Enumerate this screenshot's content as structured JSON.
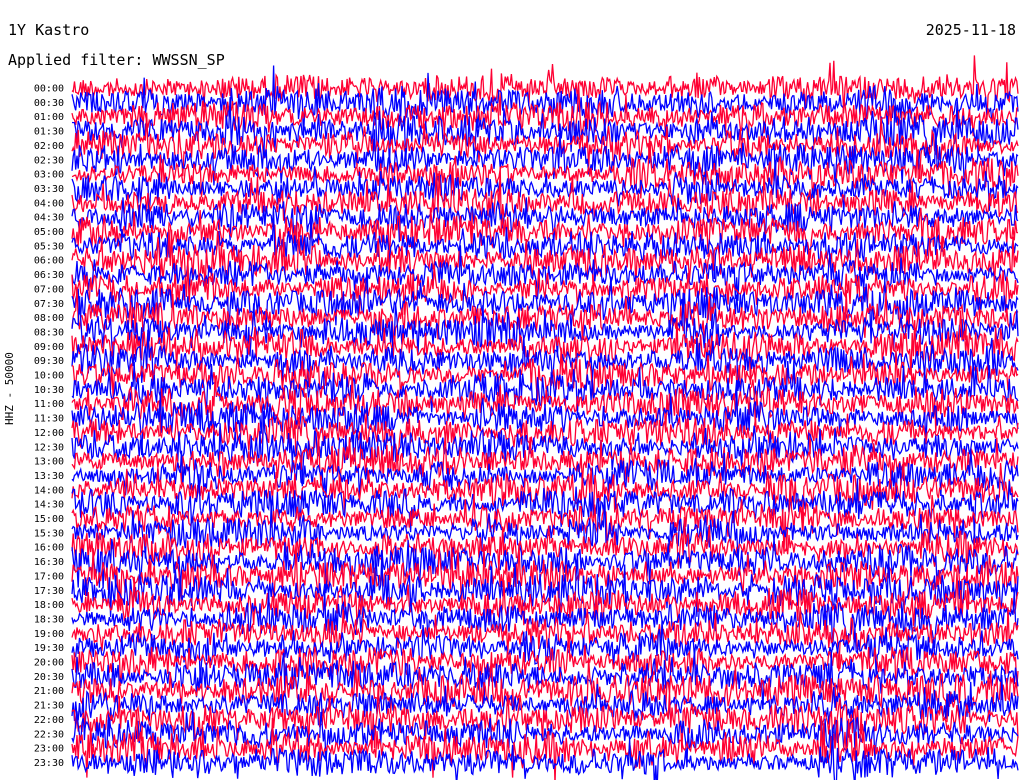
{
  "chart_data": {
    "type": "line",
    "title_left": "1Y Kastro",
    "title_right": "2025-11-18",
    "filter_label": "Applied filter: WWSSN_SP",
    "ylabel": "HHZ - 50000",
    "row_labels": [
      "00:00",
      "00:30",
      "01:00",
      "01:30",
      "02:00",
      "02:30",
      "03:00",
      "03:30",
      "04:00",
      "04:30",
      "05:00",
      "05:30",
      "06:00",
      "06:30",
      "07:00",
      "07:30",
      "08:00",
      "08:30",
      "09:00",
      "09:30",
      "10:00",
      "10:30",
      "11:00",
      "11:30",
      "12:00",
      "12:30",
      "13:00",
      "13:30",
      "14:00",
      "14:30",
      "15:00",
      "15:30",
      "16:00",
      "16:30",
      "17:00",
      "17:30",
      "18:00",
      "18:30",
      "19:00",
      "19:30",
      "20:00",
      "20:30",
      "21:00",
      "21:30",
      "22:00",
      "22:30",
      "23:00",
      "23:30"
    ],
    "series": [
      {
        "color": "#ff0033",
        "rows": "even"
      },
      {
        "color": "#0000ff",
        "rows": "odd"
      }
    ],
    "grid": false
  }
}
